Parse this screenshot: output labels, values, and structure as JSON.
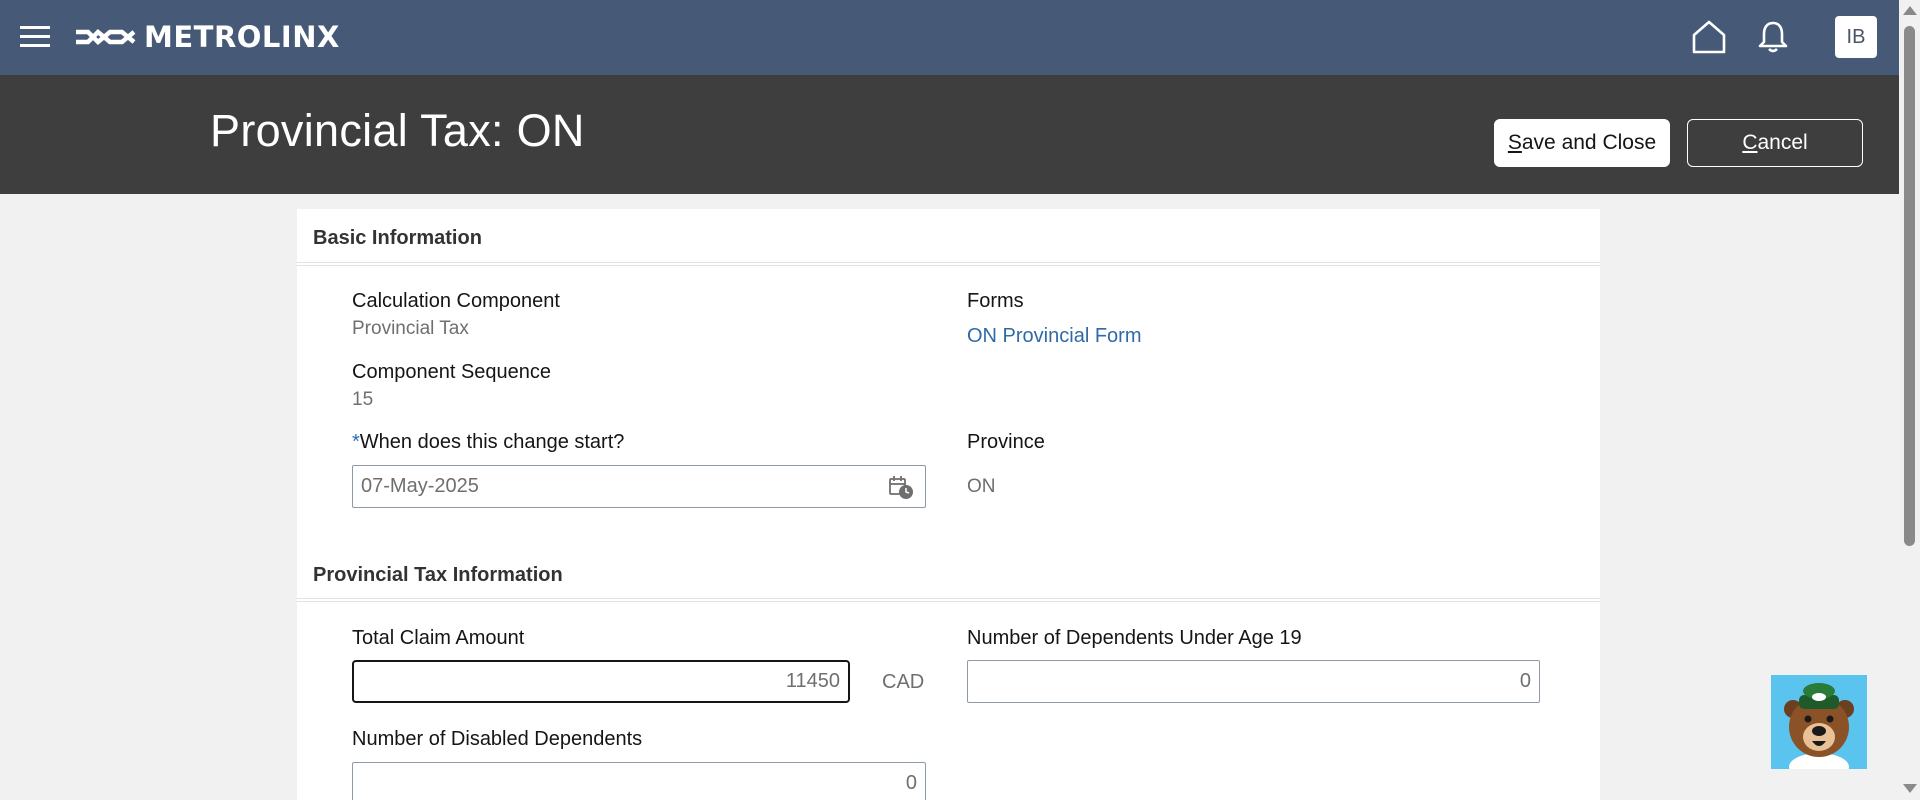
{
  "header": {
    "brand": "METROLINX",
    "user_initials": "IB"
  },
  "page": {
    "title": "Provincial Tax: ON",
    "save_label_key": "S",
    "save_label_rest": "ave and Close",
    "cancel_label_key": "C",
    "cancel_label_rest": "ancel"
  },
  "basic_info": {
    "section_title": "Basic Information",
    "calc_component_label": "Calculation Component",
    "calc_component_value": "Provincial Tax",
    "component_sequence_label": "Component Sequence",
    "component_sequence_value": "15",
    "start_label_required": "*",
    "start_label": "When does this change start?",
    "start_value": "07-May-2025",
    "forms_label": "Forms",
    "forms_link": "ON Provincial Form",
    "province_label": "Province",
    "province_value": "ON"
  },
  "provincial_info": {
    "section_title": "Provincial Tax Information",
    "total_claim_label": "Total Claim Amount",
    "total_claim_value": "11450",
    "total_claim_currency": "CAD",
    "dependents_under_19_label": "Number of Dependents Under Age 19",
    "dependents_under_19_value": "0",
    "disabled_dependents_label": "Number of Disabled Dependents",
    "disabled_dependents_value": "0"
  },
  "colors": {
    "topbar": "#465a78",
    "titlebar": "#3e3e3e",
    "link": "#2f6aa7",
    "required": "#2a6bb5"
  },
  "icons": [
    "hamburger-menu-icon",
    "metrolinx-logo-icon",
    "home-icon",
    "bell-icon",
    "calendar-icon",
    "mascot-bear-icon"
  ]
}
